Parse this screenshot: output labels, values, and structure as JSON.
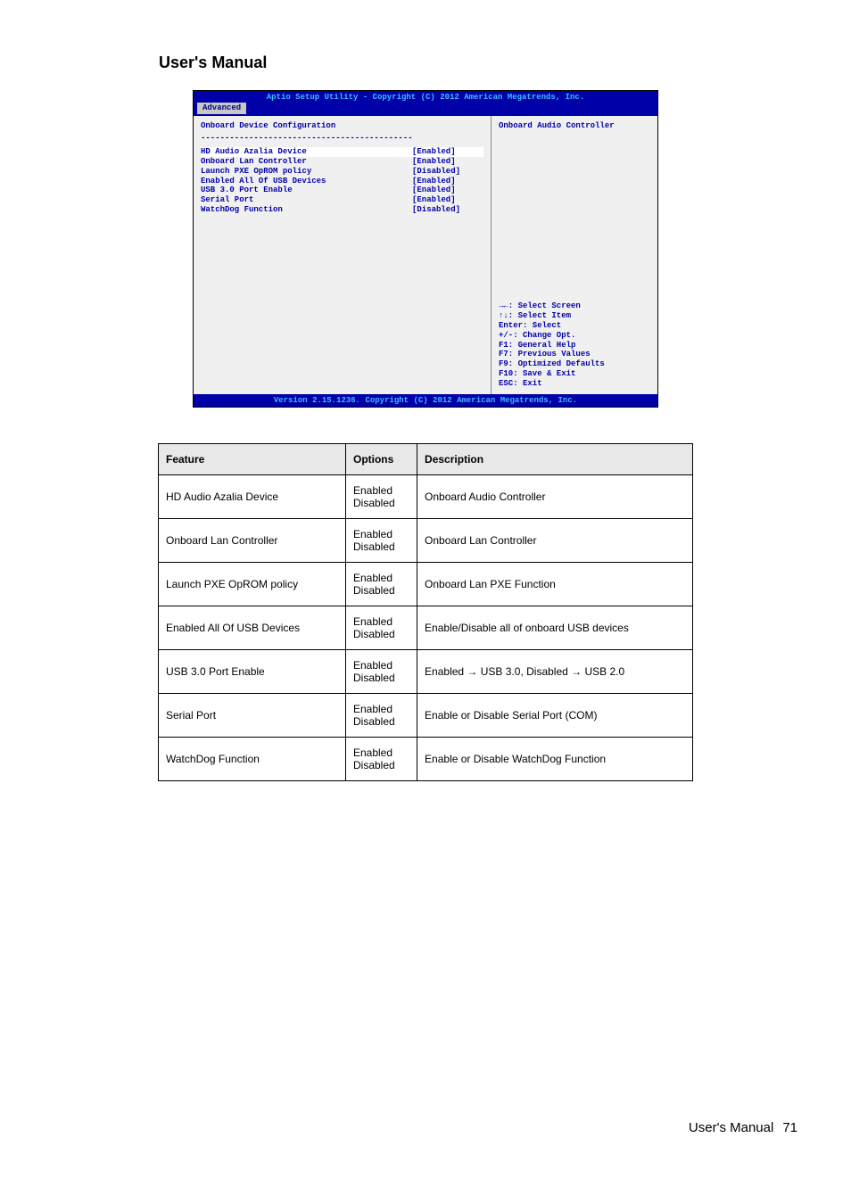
{
  "page": {
    "title": "User's Manual",
    "footer_text": "User's Manual",
    "footer_page": "71"
  },
  "bios": {
    "header": "Aptio Setup Utility - Copyright (C) 2012 American Megatrends, Inc.",
    "tab": "Advanced",
    "section_title": "Onboard Device Configuration",
    "divider": "--------------------------------------------",
    "settings": [
      {
        "label": "HD Audio Azalia Device",
        "value": "[Enabled]",
        "hl": true
      },
      {
        "label": "Onboard Lan Controller",
        "value": "[Enabled]",
        "hl": false
      },
      {
        "label": "Launch PXE OpROM policy",
        "value": "[Disabled]",
        "hl": false
      },
      {
        "label": "Enabled All Of USB Devices",
        "value": "[Enabled]",
        "hl": false
      },
      {
        "label": "USB 3.0 Port Enable",
        "value": "[Enabled]",
        "hl": false
      },
      {
        "label": "Serial Port",
        "value": "[Enabled]",
        "hl": false
      },
      {
        "label": "WatchDog Function",
        "value": "[Disabled]",
        "hl": false
      }
    ],
    "help_top": "Onboard Audio Controller",
    "help_bottom": [
      "→←: Select Screen",
      "↑↓: Select Item",
      "Enter: Select",
      "+/-: Change Opt.",
      "F1: General Help",
      "F7: Previous Values",
      "F9: Optimized Defaults",
      "F10: Save & Exit",
      "ESC: Exit"
    ],
    "footer": "Version 2.15.1236. Copyright (C) 2012 American Megatrends, Inc."
  },
  "table": {
    "headers": [
      "Feature",
      "Options",
      "Description"
    ],
    "rows": [
      [
        "HD Audio Azalia Device",
        "Enabled\nDisabled",
        "Onboard Audio Controller"
      ],
      [
        "Onboard Lan Controller",
        "Enabled\nDisabled",
        "Onboard Lan Controller"
      ],
      [
        "Launch PXE OpROM policy",
        "Enabled\nDisabled",
        "Onboard Lan PXE Function"
      ],
      [
        "Enabled All Of USB Devices",
        "Enabled\nDisabled",
        "Enable/Disable all of onboard USB devices"
      ],
      [
        "USB 3.0 Port Enable",
        "Enabled\nDisabled",
        "Enabled → USB 3.0, Disabled → USB 2.0"
      ],
      [
        "Serial Port",
        "Enabled\nDisabled",
        "Enable or Disable Serial Port (COM)"
      ],
      [
        "WatchDog Function",
        "Enabled\nDisabled",
        "Enable or Disable WatchDog Function"
      ]
    ]
  }
}
